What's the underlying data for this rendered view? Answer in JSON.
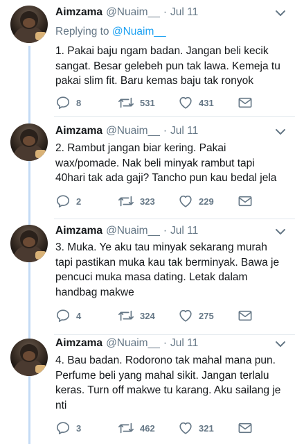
{
  "tweets": [
    {
      "name": "Aimzama",
      "handle": "@Nuaim__",
      "dot": "·",
      "date": "Jul 11",
      "replying_prefix": "Replying to ",
      "replying_to": "@Nuaim__",
      "text": "1. Pakai baju ngam badan. Jangan beli kecik sangat. Besar gelebeh pun tak lawa. Kemeja tu pakai slim fit. Baru kemas baju tak ronyok",
      "replies": "8",
      "retweets": "531",
      "likes": "431"
    },
    {
      "name": "Aimzama",
      "handle": "@Nuaim__",
      "dot": "·",
      "date": "Jul 11",
      "text": "2. Rambut jangan biar kering. Pakai wax/pomade. Nak beli minyak rambut tapi 40hari tak ada gaji? Tancho pun kau bedal jela",
      "replies": "2",
      "retweets": "323",
      "likes": "229"
    },
    {
      "name": "Aimzama",
      "handle": "@Nuaim__",
      "dot": "·",
      "date": "Jul 11",
      "text": "3. Muka. Ye aku tau minyak sekarang murah tapi pastikan muka kau tak berminyak. Bawa je pencuci muka masa dating. Letak dalam handbag makwe",
      "replies": "4",
      "retweets": "324",
      "likes": "275"
    },
    {
      "name": "Aimzama",
      "handle": "@Nuaim__",
      "dot": "·",
      "date": "Jul 11",
      "text": "4. Bau badan. Rodorono tak mahal mana pun. Perfume beli yang mahal sikit. Jangan terlalu keras. Turn off makwe tu karang. Aku sailang je nti",
      "replies": "3",
      "retweets": "462",
      "likes": "321"
    }
  ],
  "icons": {
    "reply": "reply-icon",
    "retweet": "retweet-icon",
    "like": "heart-icon",
    "message": "envelope-icon",
    "caret": "chevron-down-icon"
  },
  "colors": {
    "text": "#14171a",
    "muted": "#657786",
    "link": "#1da1f2",
    "thread_line": "#c4dbf5",
    "separator": "#e1e8ed"
  }
}
